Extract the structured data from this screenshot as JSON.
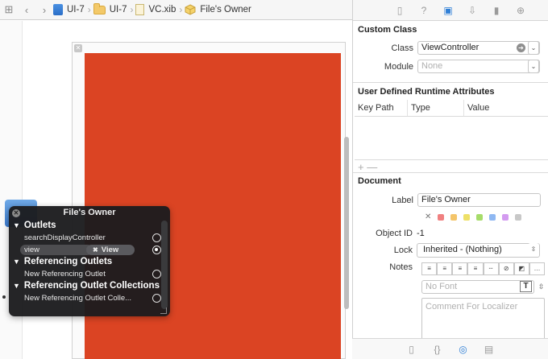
{
  "breadcrumb": {
    "items": [
      {
        "label": "UI-7",
        "icon": "project-icon"
      },
      {
        "label": "UI-7",
        "icon": "folder-icon"
      },
      {
        "label": "VC.xib",
        "icon": "xib-file-icon"
      },
      {
        "label": "File's Owner",
        "icon": "cube-icon"
      }
    ]
  },
  "hud": {
    "title": "File's Owner",
    "sections": {
      "outlets": "Outlets",
      "referencing_outlets": "Referencing Outlets",
      "referencing_collections": "Referencing Outlet Collections"
    },
    "rows": {
      "search_display": "searchDisplayController",
      "view": "view",
      "view_target": "View",
      "new_ref_outlet": "New Referencing Outlet",
      "new_ref_collection": "New Referencing Outlet Colle..."
    }
  },
  "inspector": {
    "custom_class": {
      "title": "Custom Class",
      "class_label": "Class",
      "class_value": "ViewController",
      "module_label": "Module",
      "module_placeholder": "None"
    },
    "udra": {
      "title": "User Defined Runtime Attributes",
      "col_keypath": "Key Path",
      "col_type": "Type",
      "col_value": "Value",
      "plus_minus": "+ —"
    },
    "document": {
      "title": "Document",
      "label_label": "Label",
      "label_value": "File's Owner",
      "object_id_label": "Object ID",
      "object_id_value": "-1",
      "lock_label": "Lock",
      "lock_value": "Inherited - (Nothing)",
      "notes_label": "Notes",
      "font_placeholder": "No Font",
      "comment_placeholder": "Comment For Localizer"
    }
  },
  "colors": {
    "canvas_view": "#db4423",
    "accent": "#2f7fd6",
    "swatches": [
      "#f08080",
      "#f4c56a",
      "#eee067",
      "#a6dc6a",
      "#8fb8f2",
      "#d39bf0",
      "#c8c8c8"
    ]
  }
}
